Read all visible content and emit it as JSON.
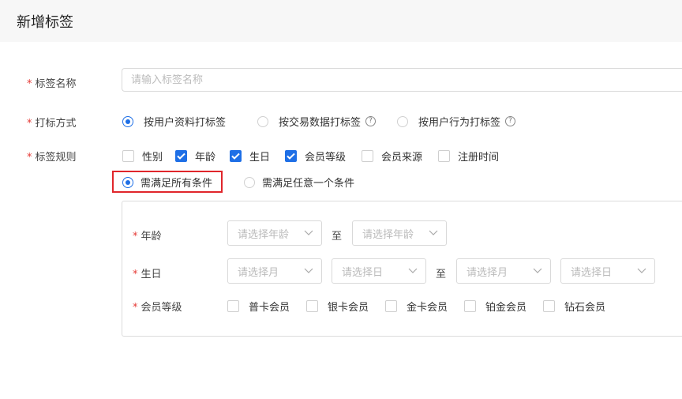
{
  "header": {
    "title": "新增标签"
  },
  "form": {
    "required_mark": "*",
    "name_label": "标签名称",
    "name_placeholder": "请输入标签名称",
    "method_label": "打标方式",
    "method_options": [
      "按用户资料打标签",
      "按交易数据打标签",
      "按用户行为打标签"
    ],
    "method_help": "?",
    "rule_label": "标签规则",
    "rule_checks": [
      "性别",
      "年龄",
      "生日",
      "会员等级",
      "会员来源",
      "注册时间"
    ],
    "match_options": [
      "需满足所有条件",
      "需满足任意一个条件"
    ]
  },
  "conditions": {
    "age": {
      "label": "年龄",
      "from_placeholder": "请选择年龄",
      "to": "至",
      "to_placeholder": "请选择年龄"
    },
    "birthday": {
      "label": "生日",
      "month_placeholder": "请选择月",
      "day_placeholder": "请选择日",
      "to": "至",
      "month2_placeholder": "请选择月",
      "day2_placeholder": "请选择日"
    },
    "level": {
      "label": "会员等级",
      "options": [
        "普卡会员",
        "银卡会员",
        "金卡会员",
        "铂金会员",
        "钻石会员"
      ]
    }
  },
  "state": {
    "selected_method": "按用户资料打标签",
    "checked_rules": [
      "年龄",
      "生日",
      "会员等级"
    ],
    "selected_match": "需满足所有条件"
  },
  "colors": {
    "accent": "#1e6fe6",
    "required": "#e53935",
    "highlight": "#e0262b"
  }
}
